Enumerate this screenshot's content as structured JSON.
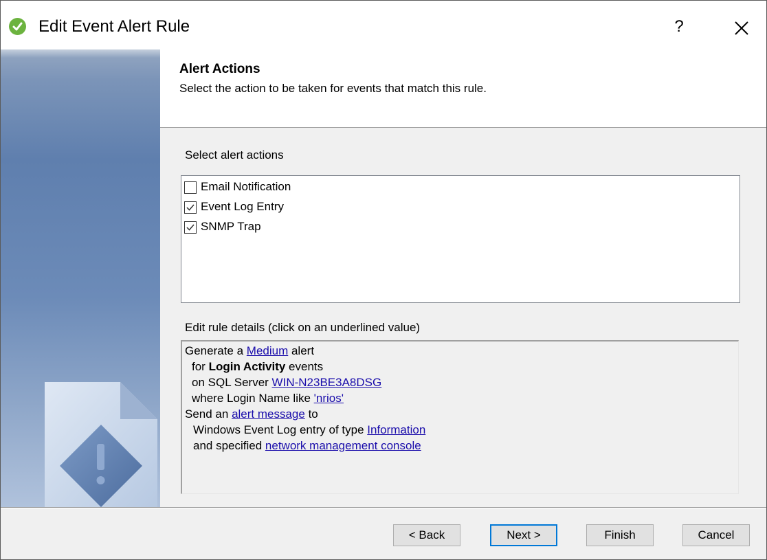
{
  "window": {
    "title": "Edit Event Alert Rule",
    "help_label": "?"
  },
  "header": {
    "title": "Alert Actions",
    "subtitle": "Select the action to be taken for events that match this rule."
  },
  "actions": {
    "label": "Select alert actions",
    "items": [
      {
        "label": "Email Notification",
        "checked": false
      },
      {
        "label": "Event Log Entry",
        "checked": true
      },
      {
        "label": "SNMP Trap",
        "checked": true
      }
    ]
  },
  "details": {
    "label": "Edit rule details (click on an underlined value)",
    "line1": {
      "pre": "Generate a ",
      "link": "Medium",
      "post": " alert"
    },
    "line2": {
      "pre": "for ",
      "bold": "Login Activity",
      "post": " events"
    },
    "line3": {
      "pre": "on SQL Server ",
      "link": "WIN-N23BE3A8DSG"
    },
    "line4": {
      "pre": "where Login Name like ",
      "link": "'nrios'"
    },
    "line5": {
      "pre": "Send an ",
      "link": "alert message",
      "post": " to"
    },
    "line6": {
      "pre": "Windows Event Log entry of type ",
      "link": "Information"
    },
    "line7": {
      "pre": "and specified ",
      "link": "network management console"
    }
  },
  "buttons": {
    "back": "< Back",
    "next": "Next >",
    "finish": "Finish",
    "cancel": "Cancel"
  },
  "colors": {
    "link": "#1a0dab",
    "app_icon": "#6cb33f",
    "default_button_border": "#0078d7"
  }
}
